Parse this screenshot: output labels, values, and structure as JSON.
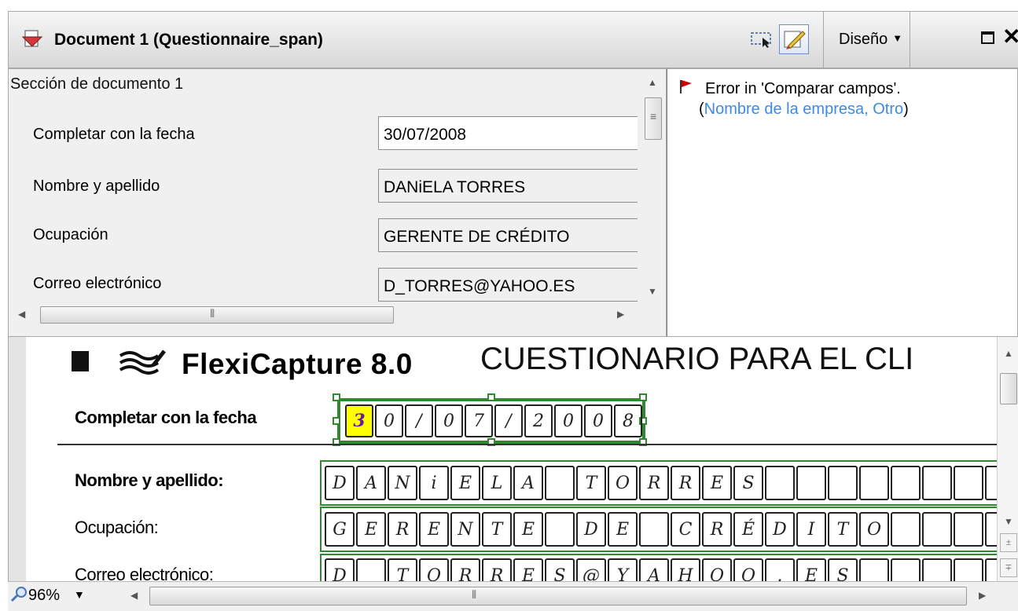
{
  "window": {
    "title": "Document 1 (Questionnaire_span)",
    "layout_menu_label": "Diseño",
    "icons": [
      "document-icon",
      "select-region-icon",
      "edit-pencil-icon",
      "restore-icon",
      "close-icon"
    ]
  },
  "fields_panel": {
    "section_title": "Sección de documento 1",
    "fields": [
      {
        "label": "Completar con la fecha",
        "value": "30/07/2008"
      },
      {
        "label": "Nombre y apellido",
        "value": "DANiELA TORRES"
      },
      {
        "label": "Ocupación",
        "value": "GERENTE DE CRÉDITO"
      },
      {
        "label": "Correo electrónico",
        "value": "D_TORRES@YAHOO.ES"
      }
    ]
  },
  "errors_panel": {
    "message": "Error in 'Comparar campos'.",
    "link_text": "Nombre de la empresa, Otro",
    "open_paren": "(",
    "close_paren": ")",
    "flag_color": "#cc0000",
    "link_color": "#3d8ae6"
  },
  "image_view": {
    "product_name": "FlexiCapture 8.0",
    "form_title": "CUESTIONARIO PARA EL CLI",
    "date_label": "Completar con la fecha",
    "date_cells": [
      "3",
      "0",
      "/",
      "0",
      "7",
      "/",
      "2",
      "0",
      "0",
      "8"
    ],
    "rows": [
      {
        "label": "Nombre y apellido:",
        "bold": true,
        "cells": [
          "D",
          "A",
          "N",
          "i",
          "E",
          "L",
          "A",
          "",
          "T",
          "O",
          "R",
          "R",
          "E",
          "S",
          "",
          "",
          "",
          "",
          "",
          "",
          "",
          ""
        ]
      },
      {
        "label": "Ocupación:",
        "bold": false,
        "cells": [
          "G",
          "E",
          "R",
          "E",
          "N",
          "T",
          "E",
          "",
          "D",
          "E",
          "",
          "C",
          "R",
          "É",
          "D",
          "I",
          "T",
          "O",
          "",
          "",
          "",
          ""
        ]
      },
      {
        "label": "Correo electrónico:",
        "bold": false,
        "cells": [
          "D",
          "_",
          "T",
          "O",
          "R",
          "R",
          "E",
          "S",
          "@",
          "Y",
          "A",
          "H",
          "O",
          "O",
          ".",
          "E",
          "S",
          "",
          "",
          "",
          "",
          ""
        ]
      }
    ],
    "highlight_color": "#ffff00",
    "frame_color": "#2f8a2f"
  },
  "statusbar": {
    "zoom": "96%"
  }
}
